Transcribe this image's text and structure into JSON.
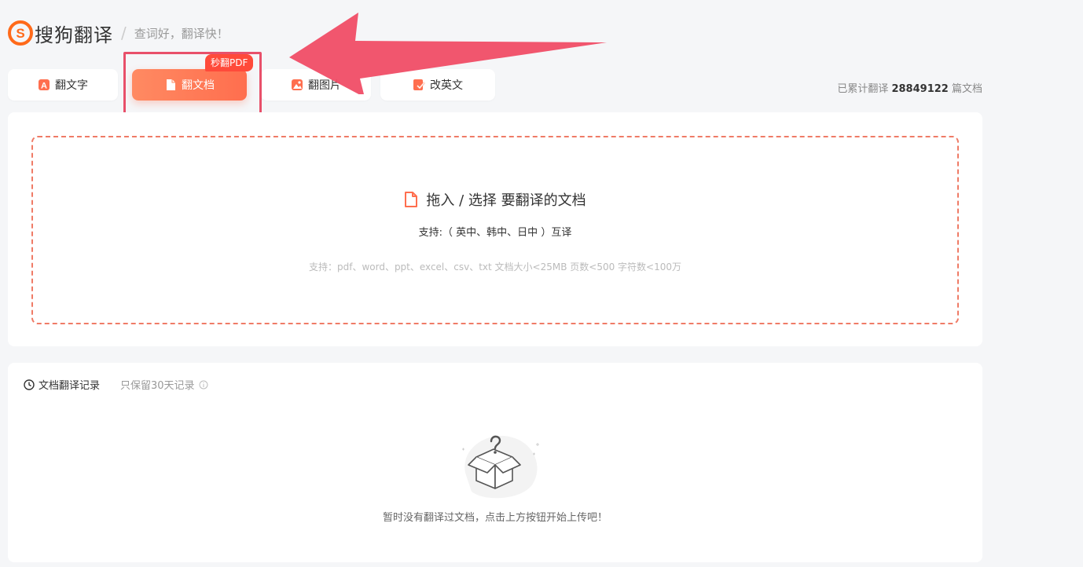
{
  "header": {
    "logo_text": "搜狗翻译",
    "separator": "/",
    "slogan": "查词好，翻译快！"
  },
  "tabs": [
    {
      "label": "翻文字",
      "icon": "text-translate-icon"
    },
    {
      "label": "翻文档",
      "icon": "document-icon",
      "active": true
    },
    {
      "label": "翻图片",
      "icon": "image-icon"
    },
    {
      "label": "改英文",
      "icon": "edit-check-icon"
    }
  ],
  "badge": "秒翻PDF",
  "stats": {
    "prefix": "已累计翻译",
    "count": "28849122",
    "suffix": "篇文档"
  },
  "upload": {
    "title": "拖入 / 选择 要翻译的文档",
    "languages": "支持:（ 英中、韩中、日中 ）互译",
    "formats": "支持：pdf、word、ppt、excel、csv、txt   文档大小<25MB 页数<500 字符数<100万"
  },
  "history": {
    "title": "文档翻译记录",
    "note": "只保留30天记录",
    "empty_text": "暂时没有翻译过文档，点击上方按钮开始上传吧！"
  },
  "colors": {
    "accent": "#ff6e4e",
    "badge": "#ff4a3a",
    "annotation": "#f0506a"
  }
}
